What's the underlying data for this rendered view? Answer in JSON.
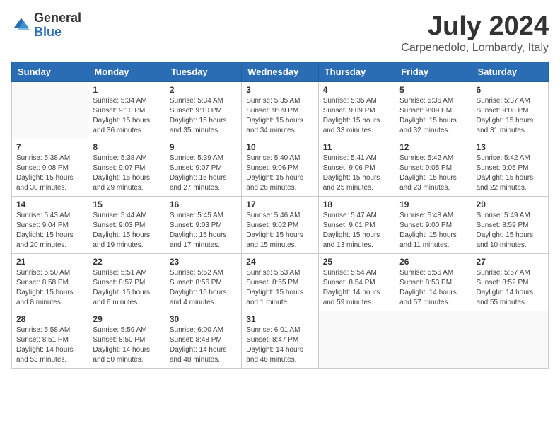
{
  "logo": {
    "general": "General",
    "blue": "Blue"
  },
  "title": {
    "month": "July 2024",
    "location": "Carpenedolo, Lombardy, Italy"
  },
  "days_of_week": [
    "Sunday",
    "Monday",
    "Tuesday",
    "Wednesday",
    "Thursday",
    "Friday",
    "Saturday"
  ],
  "weeks": [
    [
      {
        "day": "",
        "info": ""
      },
      {
        "day": "1",
        "info": "Sunrise: 5:34 AM\nSunset: 9:10 PM\nDaylight: 15 hours\nand 36 minutes."
      },
      {
        "day": "2",
        "info": "Sunrise: 5:34 AM\nSunset: 9:10 PM\nDaylight: 15 hours\nand 35 minutes."
      },
      {
        "day": "3",
        "info": "Sunrise: 5:35 AM\nSunset: 9:09 PM\nDaylight: 15 hours\nand 34 minutes."
      },
      {
        "day": "4",
        "info": "Sunrise: 5:35 AM\nSunset: 9:09 PM\nDaylight: 15 hours\nand 33 minutes."
      },
      {
        "day": "5",
        "info": "Sunrise: 5:36 AM\nSunset: 9:09 PM\nDaylight: 15 hours\nand 32 minutes."
      },
      {
        "day": "6",
        "info": "Sunrise: 5:37 AM\nSunset: 9:08 PM\nDaylight: 15 hours\nand 31 minutes."
      }
    ],
    [
      {
        "day": "7",
        "info": "Sunrise: 5:38 AM\nSunset: 9:08 PM\nDaylight: 15 hours\nand 30 minutes."
      },
      {
        "day": "8",
        "info": "Sunrise: 5:38 AM\nSunset: 9:07 PM\nDaylight: 15 hours\nand 29 minutes."
      },
      {
        "day": "9",
        "info": "Sunrise: 5:39 AM\nSunset: 9:07 PM\nDaylight: 15 hours\nand 27 minutes."
      },
      {
        "day": "10",
        "info": "Sunrise: 5:40 AM\nSunset: 9:06 PM\nDaylight: 15 hours\nand 26 minutes."
      },
      {
        "day": "11",
        "info": "Sunrise: 5:41 AM\nSunset: 9:06 PM\nDaylight: 15 hours\nand 25 minutes."
      },
      {
        "day": "12",
        "info": "Sunrise: 5:42 AM\nSunset: 9:05 PM\nDaylight: 15 hours\nand 23 minutes."
      },
      {
        "day": "13",
        "info": "Sunrise: 5:42 AM\nSunset: 9:05 PM\nDaylight: 15 hours\nand 22 minutes."
      }
    ],
    [
      {
        "day": "14",
        "info": "Sunrise: 5:43 AM\nSunset: 9:04 PM\nDaylight: 15 hours\nand 20 minutes."
      },
      {
        "day": "15",
        "info": "Sunrise: 5:44 AM\nSunset: 9:03 PM\nDaylight: 15 hours\nand 19 minutes."
      },
      {
        "day": "16",
        "info": "Sunrise: 5:45 AM\nSunset: 9:03 PM\nDaylight: 15 hours\nand 17 minutes."
      },
      {
        "day": "17",
        "info": "Sunrise: 5:46 AM\nSunset: 9:02 PM\nDaylight: 15 hours\nand 15 minutes."
      },
      {
        "day": "18",
        "info": "Sunrise: 5:47 AM\nSunset: 9:01 PM\nDaylight: 15 hours\nand 13 minutes."
      },
      {
        "day": "19",
        "info": "Sunrise: 5:48 AM\nSunset: 9:00 PM\nDaylight: 15 hours\nand 11 minutes."
      },
      {
        "day": "20",
        "info": "Sunrise: 5:49 AM\nSunset: 8:59 PM\nDaylight: 15 hours\nand 10 minutes."
      }
    ],
    [
      {
        "day": "21",
        "info": "Sunrise: 5:50 AM\nSunset: 8:58 PM\nDaylight: 15 hours\nand 8 minutes."
      },
      {
        "day": "22",
        "info": "Sunrise: 5:51 AM\nSunset: 8:57 PM\nDaylight: 15 hours\nand 6 minutes."
      },
      {
        "day": "23",
        "info": "Sunrise: 5:52 AM\nSunset: 8:56 PM\nDaylight: 15 hours\nand 4 minutes."
      },
      {
        "day": "24",
        "info": "Sunrise: 5:53 AM\nSunset: 8:55 PM\nDaylight: 15 hours\nand 1 minute."
      },
      {
        "day": "25",
        "info": "Sunrise: 5:54 AM\nSunset: 8:54 PM\nDaylight: 14 hours\nand 59 minutes."
      },
      {
        "day": "26",
        "info": "Sunrise: 5:56 AM\nSunset: 8:53 PM\nDaylight: 14 hours\nand 57 minutes."
      },
      {
        "day": "27",
        "info": "Sunrise: 5:57 AM\nSunset: 8:52 PM\nDaylight: 14 hours\nand 55 minutes."
      }
    ],
    [
      {
        "day": "28",
        "info": "Sunrise: 5:58 AM\nSunset: 8:51 PM\nDaylight: 14 hours\nand 53 minutes."
      },
      {
        "day": "29",
        "info": "Sunrise: 5:59 AM\nSunset: 8:50 PM\nDaylight: 14 hours\nand 50 minutes."
      },
      {
        "day": "30",
        "info": "Sunrise: 6:00 AM\nSunset: 8:48 PM\nDaylight: 14 hours\nand 48 minutes."
      },
      {
        "day": "31",
        "info": "Sunrise: 6:01 AM\nSunset: 8:47 PM\nDaylight: 14 hours\nand 46 minutes."
      },
      {
        "day": "",
        "info": ""
      },
      {
        "day": "",
        "info": ""
      },
      {
        "day": "",
        "info": ""
      }
    ]
  ]
}
